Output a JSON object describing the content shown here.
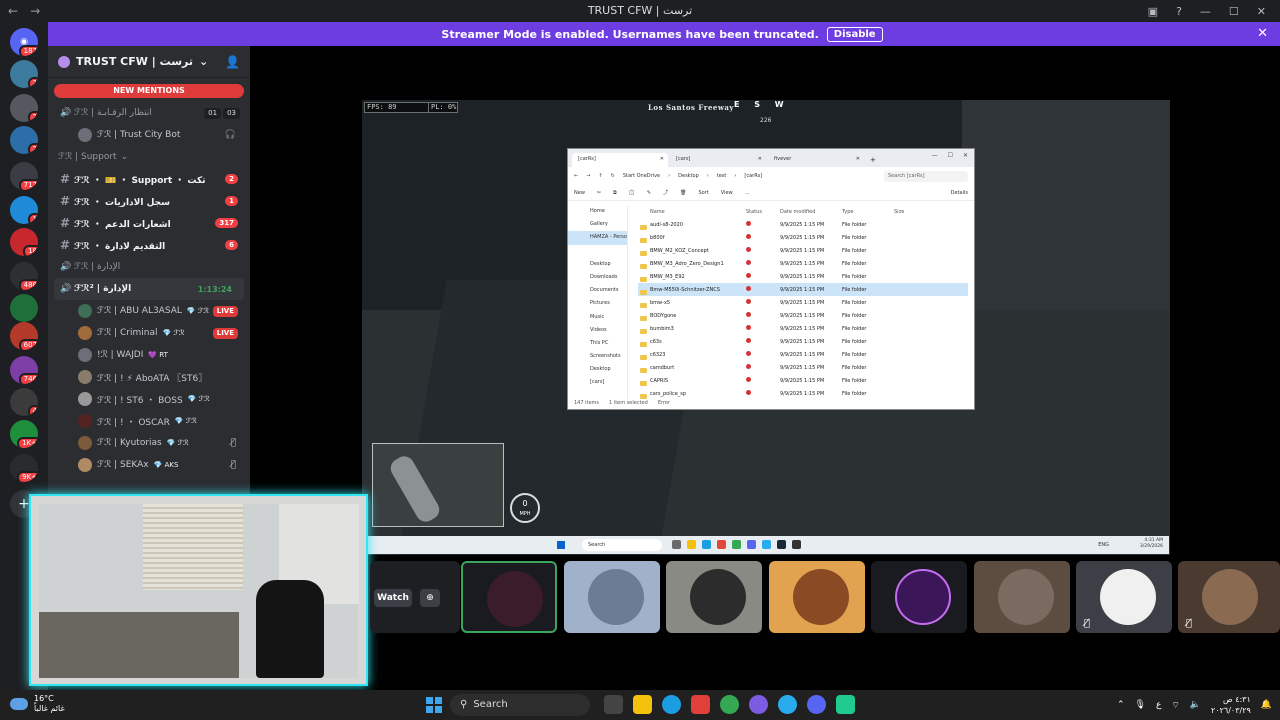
{
  "window": {
    "title": "TRUST CFW | ترست",
    "nav_back": "←",
    "nav_forward": "→"
  },
  "banner": {
    "text": "Streamer Mode is enabled. Usernames have been truncated.",
    "disable_label": "Disable"
  },
  "server_rail": {
    "badges": [
      "187",
      "2",
      "2",
      "2",
      "717",
      "1",
      "18",
      "488",
      "",
      "607",
      "746",
      "4",
      "1K+",
      "9K+"
    ]
  },
  "sidebar": {
    "server_name": "TRUST CFW | ترست",
    "new_mentions": "NEW MENTIONS",
    "top_voice": {
      "label": "ℱℛ | انتظار الرقـابـة",
      "count_a": "01",
      "count_b": "03"
    },
    "top_member": {
      "label": "ℱℛ | Trust City Bot"
    },
    "category": "ℱℛ | Support",
    "channels": [
      {
        "label": "ℱℛ ・ 🎫 ・ Support ・ تكت",
        "badge": "2"
      },
      {
        "label": "ℱℛ ・ سجل الاداريات",
        "badge": "1"
      },
      {
        "label": "ℱℛ ・ اشعارات الدعم",
        "badge": "317"
      },
      {
        "label": "ℱℛ ・ التقديم لادارة",
        "badge": "6"
      }
    ],
    "voice_admin": "ℱℛ | الإدارة",
    "voice_admin2": {
      "label": "ℱℛ² | الإدارة",
      "timer": "1:13:24"
    },
    "members": [
      {
        "name": "ℱℛ | ABU AL3ASAL",
        "tag": "💎 ℱℛ",
        "status": "LIVE"
      },
      {
        "name": "ℱℛ | Criminal",
        "tag": "💎 ℱℛ",
        "status": "LIVE"
      },
      {
        "name": "!ℛ | WAJDI",
        "tag": "💜 RT",
        "status": ""
      },
      {
        "name": "ℱℛ | ! ⚡ AboATA 〖ST6〗",
        "tag": "",
        "status": ""
      },
      {
        "name": "ℱℛ | ! ST6 ・ BOSS",
        "tag": "💎 ℱℛ",
        "status": ""
      },
      {
        "name": "ℱℛ | ! ・ OSCAR",
        "tag": "💎 ℱℛ",
        "status": ""
      },
      {
        "name": "ℱℛ | Kyutorias",
        "tag": "💎 ℱℛ",
        "status": "muted"
      },
      {
        "name": "ℱℛ | SEKAx",
        "tag": "💎 AKS",
        "status": "muted"
      }
    ]
  },
  "game": {
    "fps": "FPS: 89",
    "pl": "PL: 0%",
    "street": "Los Santos Freeway",
    "compass": "E S W",
    "heading": "226",
    "speed": "0",
    "speed_unit": "MPH"
  },
  "explorer": {
    "tabs": [
      "[carRs]",
      "[cars]",
      "fivever"
    ],
    "breadcrumbs": [
      "Start OneDrive",
      "Desktop",
      "test",
      "[carRs]"
    ],
    "search_placeholder": "Search [carRs]",
    "commands": [
      "New",
      "Sort",
      "View",
      "Details"
    ],
    "nav": [
      "Home",
      "Gallery",
      "HAMZA - Perso",
      "",
      "Desktop",
      "Downloads",
      "Documents",
      "Pictures",
      "Music",
      "Videos",
      "This PC",
      "Screenshots",
      "Desktop",
      "[cars]"
    ],
    "columns": [
      "Name",
      "Status",
      "Date modified",
      "Type",
      "Size"
    ],
    "rows": [
      {
        "name": "audi-s8-2020",
        "date": "9/9/2025 1:15 PM",
        "type": "File folder"
      },
      {
        "name": "b800f",
        "date": "9/9/2025 1:15 PM",
        "type": "File folder"
      },
      {
        "name": "BMW_M2_KOZ_Concept",
        "date": "9/9/2025 1:15 PM",
        "type": "File folder"
      },
      {
        "name": "BMW_M3_Adro_Zero_Design1",
        "date": "9/9/2025 1:15 PM",
        "type": "File folder"
      },
      {
        "name": "BMW_M3_E92",
        "date": "9/9/2025 1:15 PM",
        "type": "File folder"
      },
      {
        "name": "Bmw-M550i-Schnitzer-ZNCS",
        "date": "9/9/2025 1:15 PM",
        "type": "File folder"
      },
      {
        "name": "bmw-x5",
        "date": "9/9/2025 1:15 PM",
        "type": "File folder"
      },
      {
        "name": "BODYgone",
        "date": "9/9/2025 1:15 PM",
        "type": "File folder"
      },
      {
        "name": "bumbim3",
        "date": "9/9/2025 1:15 PM",
        "type": "File folder"
      },
      {
        "name": "c63s",
        "date": "9/9/2025 1:15 PM",
        "type": "File folder"
      },
      {
        "name": "c6323",
        "date": "9/9/2025 1:15 PM",
        "type": "File folder"
      },
      {
        "name": "camdburt",
        "date": "9/9/2025 1:15 PM",
        "type": "File folder"
      },
      {
        "name": "CAPRIS",
        "date": "9/9/2025 1:15 PM",
        "type": "File folder"
      },
      {
        "name": "cars_police_sp",
        "date": "9/9/2025 1:15 PM",
        "type": "File folder"
      }
    ],
    "status": [
      "147 items",
      "1 item selected",
      "Error"
    ]
  },
  "game_taskbar": {
    "search": "Search",
    "lang": "ENG",
    "time": "4:31 AM",
    "date": "3/29/2026"
  },
  "stage": {
    "watch_label": "Watch"
  },
  "taskbar": {
    "temp": "16°C",
    "weather": "غائم غالباً",
    "search": "Search",
    "lang": "ع",
    "time": "٤:٣١ ص",
    "date": "٢٠٢٦/٠٣/٢٩"
  }
}
